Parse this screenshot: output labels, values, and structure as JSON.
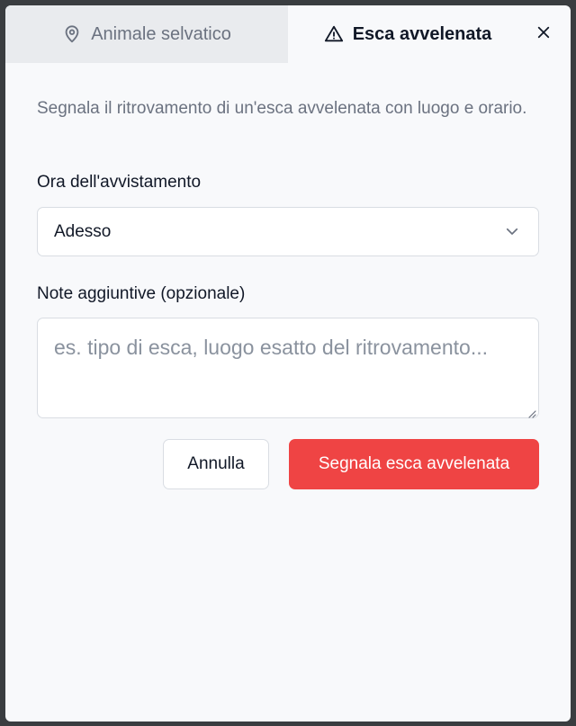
{
  "tabs": [
    {
      "label": "Animale selvatico",
      "icon": "map-pin-icon",
      "active": false
    },
    {
      "label": "Esca avvelenata",
      "icon": "warning-triangle-icon",
      "active": true
    }
  ],
  "form": {
    "description": "Segnala il ritrovamento di un'esca avvelenata con luogo e orario.",
    "time_label": "Ora dell'avvistamento",
    "time_value": "Adesso",
    "notes_label": "Note aggiuntive (opzionale)",
    "notes_placeholder": "es. tipo di esca, luogo esatto del ritrovamento..."
  },
  "actions": {
    "cancel_label": "Annulla",
    "submit_label": "Segnala esca avvelenata"
  },
  "colors": {
    "accent": "#ef4444",
    "text": "#111827",
    "muted": "#6b7280"
  }
}
